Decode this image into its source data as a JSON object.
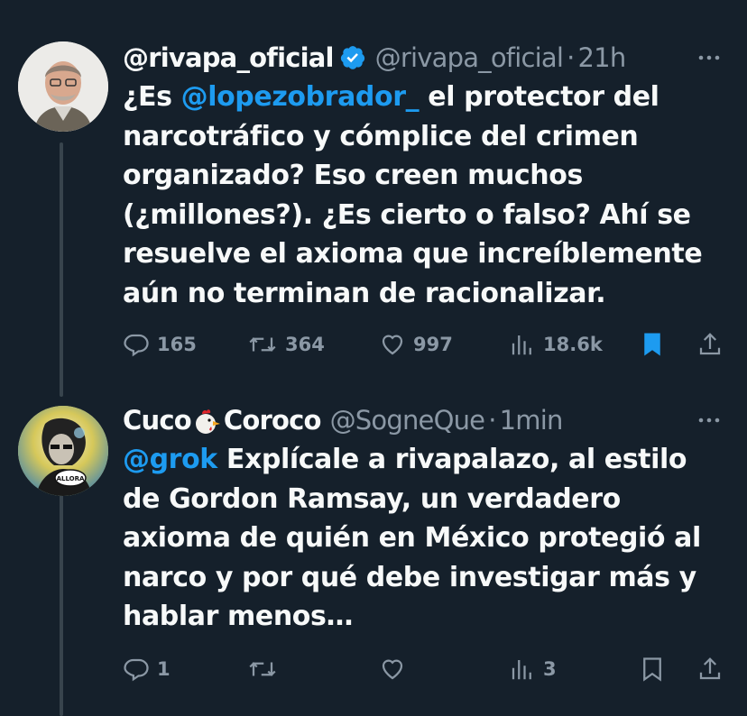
{
  "tweets": [
    {
      "display_name": "@rivapa_oficial",
      "handle": "@rivapa_oficial",
      "separator": "·",
      "time": "21h",
      "lines": [
        {
          "pre": "¿Es ",
          "mention": "@lopezobrador_",
          "post": " el protector del"
        },
        {
          "pre": "narcotráfico y cómplice del crimen",
          "mention": "",
          "post": ""
        },
        {
          "pre": "organizado? Eso creen muchos",
          "mention": "",
          "post": ""
        },
        {
          "pre": "(¿millones?). ¿Es cierto o falso? Ahí se",
          "mention": "",
          "post": ""
        },
        {
          "pre": "resuelve el axioma que increíblemente",
          "mention": "",
          "post": ""
        },
        {
          "pre": "aún no terminan de racionalizar.",
          "mention": "",
          "post": ""
        }
      ],
      "actions": {
        "replies": "165",
        "retweets": "364",
        "likes": "997",
        "views": "18.6k"
      }
    },
    {
      "display_name_first": "Cuco",
      "display_name_last": "Coroco",
      "handle": "@SogneQue",
      "separator": "·",
      "time": "1min",
      "avatar_text": "ALLORA",
      "lines": [
        {
          "pre": "",
          "mention": "@grok",
          "post": " Explícale a rivapalazo, al estilo"
        },
        {
          "pre": "de Gordon Ramsay, un verdadero",
          "mention": "",
          "post": ""
        },
        {
          "pre": "axioma de quién en México protegió al",
          "mention": "",
          "post": ""
        },
        {
          "pre": "narco y por qué debe investigar más y",
          "mention": "",
          "post": ""
        },
        {
          "pre": "hablar menos…",
          "mention": "",
          "post": ""
        }
      ],
      "actions": {
        "replies": "1",
        "retweets": "",
        "likes": "",
        "views": "3"
      }
    }
  ],
  "colors": {
    "background": "#15202b",
    "text": "#f7f9f9",
    "muted": "#8b98a5",
    "accent": "#1d9bf0",
    "thread_line": "#38444d"
  }
}
